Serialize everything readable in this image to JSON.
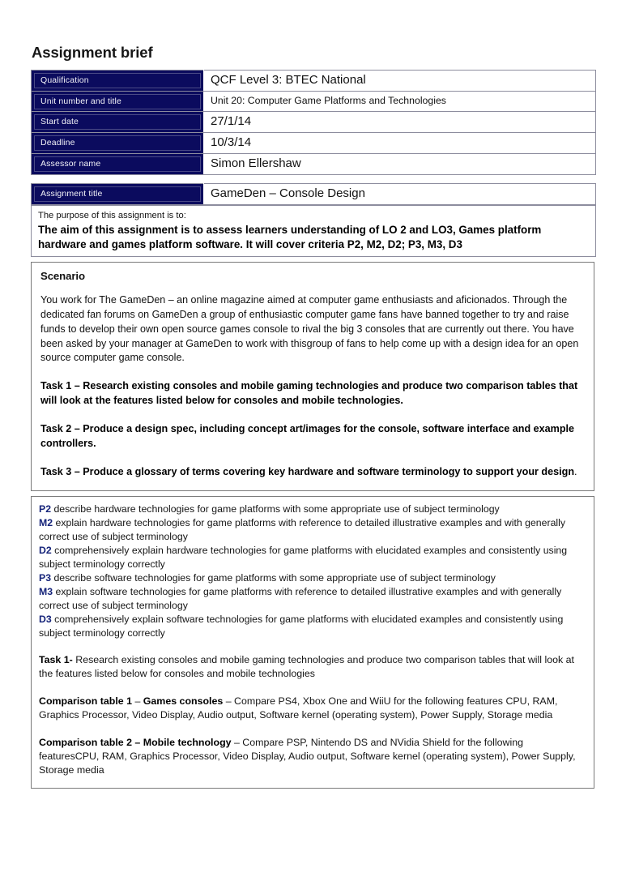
{
  "document": {
    "title": "Assignment brief"
  },
  "info_table": {
    "rows": [
      {
        "label": "Qualification",
        "value": "QCF Level 3: BTEC National",
        "size": "large"
      },
      {
        "label": "Unit number and title",
        "value": "Unit 20: Computer Game Platforms and Technologies",
        "size": "small"
      },
      {
        "label": "Start date",
        "value": "27/1/14",
        "size": "large"
      },
      {
        "label": "Deadline",
        "value": "10/3/14",
        "size": "large"
      },
      {
        "label": "Assessor name",
        "value": "Simon Ellershaw",
        "size": "large"
      }
    ]
  },
  "assignment": {
    "title_label": "Assignment title",
    "title_value": "GameDen – Console Design",
    "purpose_lead": "The purpose of this assignment is to:",
    "purpose_aim": "The aim of this assignment is to assess learners understanding of LO 2 and LO3, Games platform hardware and games platform software. It will cover criteria P2, M2, D2; P3, M3, D3"
  },
  "scenario": {
    "heading": "Scenario",
    "body": "You work for The GameDen – an online magazine aimed at computer game enthusiasts and aficionados. Through the dedicated fan forums on GameDen a group of enthusiastic computer game fans have banned together to try and raise funds to develop their own open source games console to rival the big 3 consoles that are currently out there.  You have been asked by your manager at GameDen to work with thisgroup of fans to help come up with a design idea for an open source computer game console.",
    "task1": "Task 1 – Research existing consoles and mobile gaming technologies and produce two comparison tables that will look at the features listed below for consoles and mobile technologies.",
    "task2": "Task 2 – Produce a design spec, including concept art/images for the console, software interface and example controllers.",
    "task3_bold": "Task 3 – Produce a glossary of terms covering key hardware and software terminology to support your design",
    "task3_tail": "."
  },
  "criteria": {
    "items": [
      {
        "code": "P2",
        "text": " describe hardware technologies for game platforms with some appropriate use of subject terminology"
      },
      {
        "code": "M2",
        "text": " explain hardware technologies for game platforms with reference to detailed illustrative examples and with generally correct use of subject terminology"
      },
      {
        "code": "D2",
        "text": " comprehensively explain hardware technologies for game platforms with elucidated examples and consistently using subject terminology correctly"
      },
      {
        "code": "P3",
        "text": " describe software technologies for game platforms with some appropriate use of subject terminology"
      },
      {
        "code": "M3",
        "text": " explain software technologies for game platforms with reference to detailed illustrative examples and with generally correct use of subject terminology"
      },
      {
        "code": "D3",
        "text": " comprehensively explain software technologies for game platforms with elucidated examples and consistently using subject terminology correctly"
      }
    ],
    "task1_bold": "Task 1-",
    "task1_text": " Research existing consoles and mobile gaming technologies and produce two comparison tables that will look at the features listed below for consoles and mobile technologies",
    "table1_bold_a": "Comparison table 1 ",
    "table1_mid": "– ",
    "table1_bold_b": "Games consoles",
    "table1_text": " – Compare PS4, Xbox One and WiiU for the following features CPU, RAM, Graphics Processor, Video Display, Audio output, Software kernel (operating system), Power Supply, Storage media",
    "table2_bold_a": "Comparison table 2 – ",
    "table2_bold_b": "Mobile technology",
    "table2_text": " – Compare PSP, Nintendo DS and NVidia Shield for the following featuresCPU, RAM, Graphics Processor, Video Display, Audio output, Software kernel (operating system), Power Supply, Storage media"
  },
  "colors": {
    "label_navy": "#0b0b5e",
    "code_blue": "#16247a",
    "border_gray": "#7a7a7a"
  }
}
